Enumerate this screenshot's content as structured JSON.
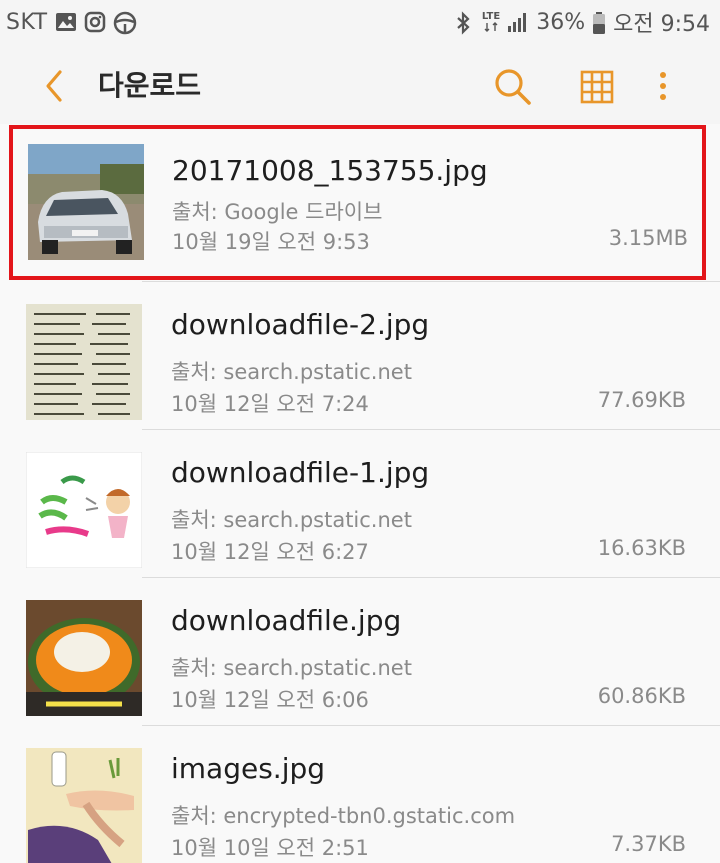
{
  "status_bar": {
    "carrier": "SKT",
    "network": "LTE",
    "battery": "36%",
    "time": "오전 9:54",
    "icons": [
      "gallery-icon",
      "instagram-icon",
      "steering-wheel-icon",
      "bluetooth-icon",
      "signal-icon",
      "battery-icon"
    ]
  },
  "toolbar": {
    "title": "다운로드",
    "accent_color": "#e8962a",
    "icons": [
      "back-icon",
      "search-icon",
      "grid-view-icon",
      "more-icon"
    ]
  },
  "highlight_color": "#e3151a",
  "files": [
    {
      "name": "20171008_153755.jpg",
      "source": "출처: Google 드라이브",
      "date": "10월 19일 오전 9:53",
      "size": "3.15MB"
    },
    {
      "name": "downloadfile-2.jpg",
      "source": "출처: search.pstatic.net",
      "date": "10월 12일 오전 7:24",
      "size": "77.69KB"
    },
    {
      "name": "downloadfile-1.jpg",
      "source": "출처: search.pstatic.net",
      "date": "10월 12일 오전 6:27",
      "size": "16.63KB"
    },
    {
      "name": "downloadfile.jpg",
      "source": "출처: search.pstatic.net",
      "date": "10월 12일 오전 6:06",
      "size": "60.86KB"
    },
    {
      "name": "images.jpg",
      "source": "출처: encrypted-tbn0.gstatic.com",
      "date": "10월 10일 오전 2:51",
      "size": "7.37KB"
    }
  ]
}
